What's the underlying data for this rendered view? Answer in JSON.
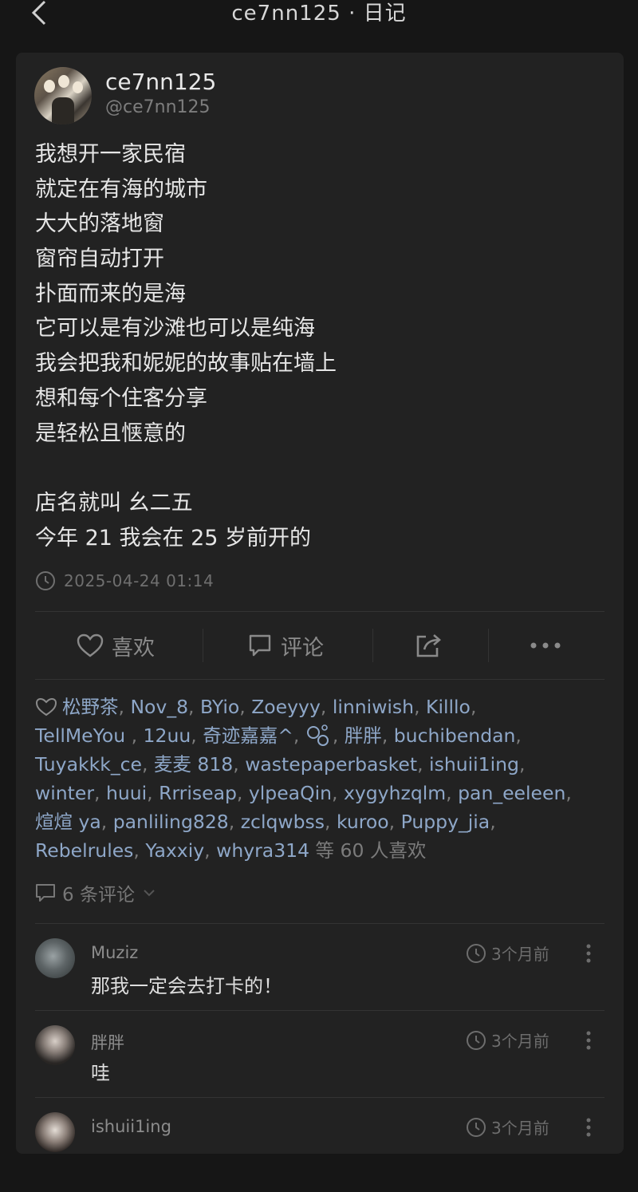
{
  "header": {
    "title": "ce7nn125 · 日记"
  },
  "post": {
    "username": "ce7nn125",
    "handle": "@ce7nn125",
    "lines": [
      "我想开一家民宿",
      "就定在有海的城市",
      "大大的落地窗",
      "窗帘自动打开",
      "扑面而来的是海",
      "它可以是有沙滩也可以是纯海",
      "我会把我和妮妮的故事贴在墙上",
      "想和每个住客分享",
      "是轻松且惬意的",
      "",
      "店名就叫 幺二五",
      "今年 21 我会在 25 岁前开的"
    ],
    "timestamp": "2025-04-24 01:14"
  },
  "actions": {
    "like_label": "喜欢",
    "comment_label": "评论",
    "share_icon": "share-icon",
    "more_icon": "more-icon"
  },
  "likes": {
    "users": [
      "松野茶",
      "Nov_8",
      "BYio",
      "Zoeyyy",
      "linniwish",
      "Killlo",
      "TellMeYou",
      "12uu",
      "奇迹嘉嘉^",
      "",
      "胖胖",
      "buchibendan",
      "Tuyakkk_ce",
      "麦麦 818",
      "wastepaperbasket",
      "ishuii1ing",
      "winter",
      "huui",
      "Rrriseap",
      "ylpeaQin",
      "xygyhzqlm",
      "pan_eeleen",
      "煊煊 ya",
      "panliling828",
      "zclqwbss",
      "kuroo",
      "Puppy_jia",
      "Rebelrules",
      "Yaxxiy",
      "whyra314"
    ],
    "suffix_a": "等",
    "count": "60",
    "suffix_b": "人喜欢"
  },
  "comments_summary": "6 条评论",
  "comments": [
    {
      "name": "Muziz",
      "text": "那我一定会去打卡的！",
      "time": "3个月前"
    },
    {
      "name": "胖胖",
      "text": "哇",
      "time": "3个月前"
    },
    {
      "name": "ishuii1ing",
      "text": "",
      "time": "3个月前"
    }
  ],
  "colors": {
    "background": "#161616",
    "card": "#222222",
    "link": "#8ea7c8",
    "muted": "#7b7b7b"
  }
}
